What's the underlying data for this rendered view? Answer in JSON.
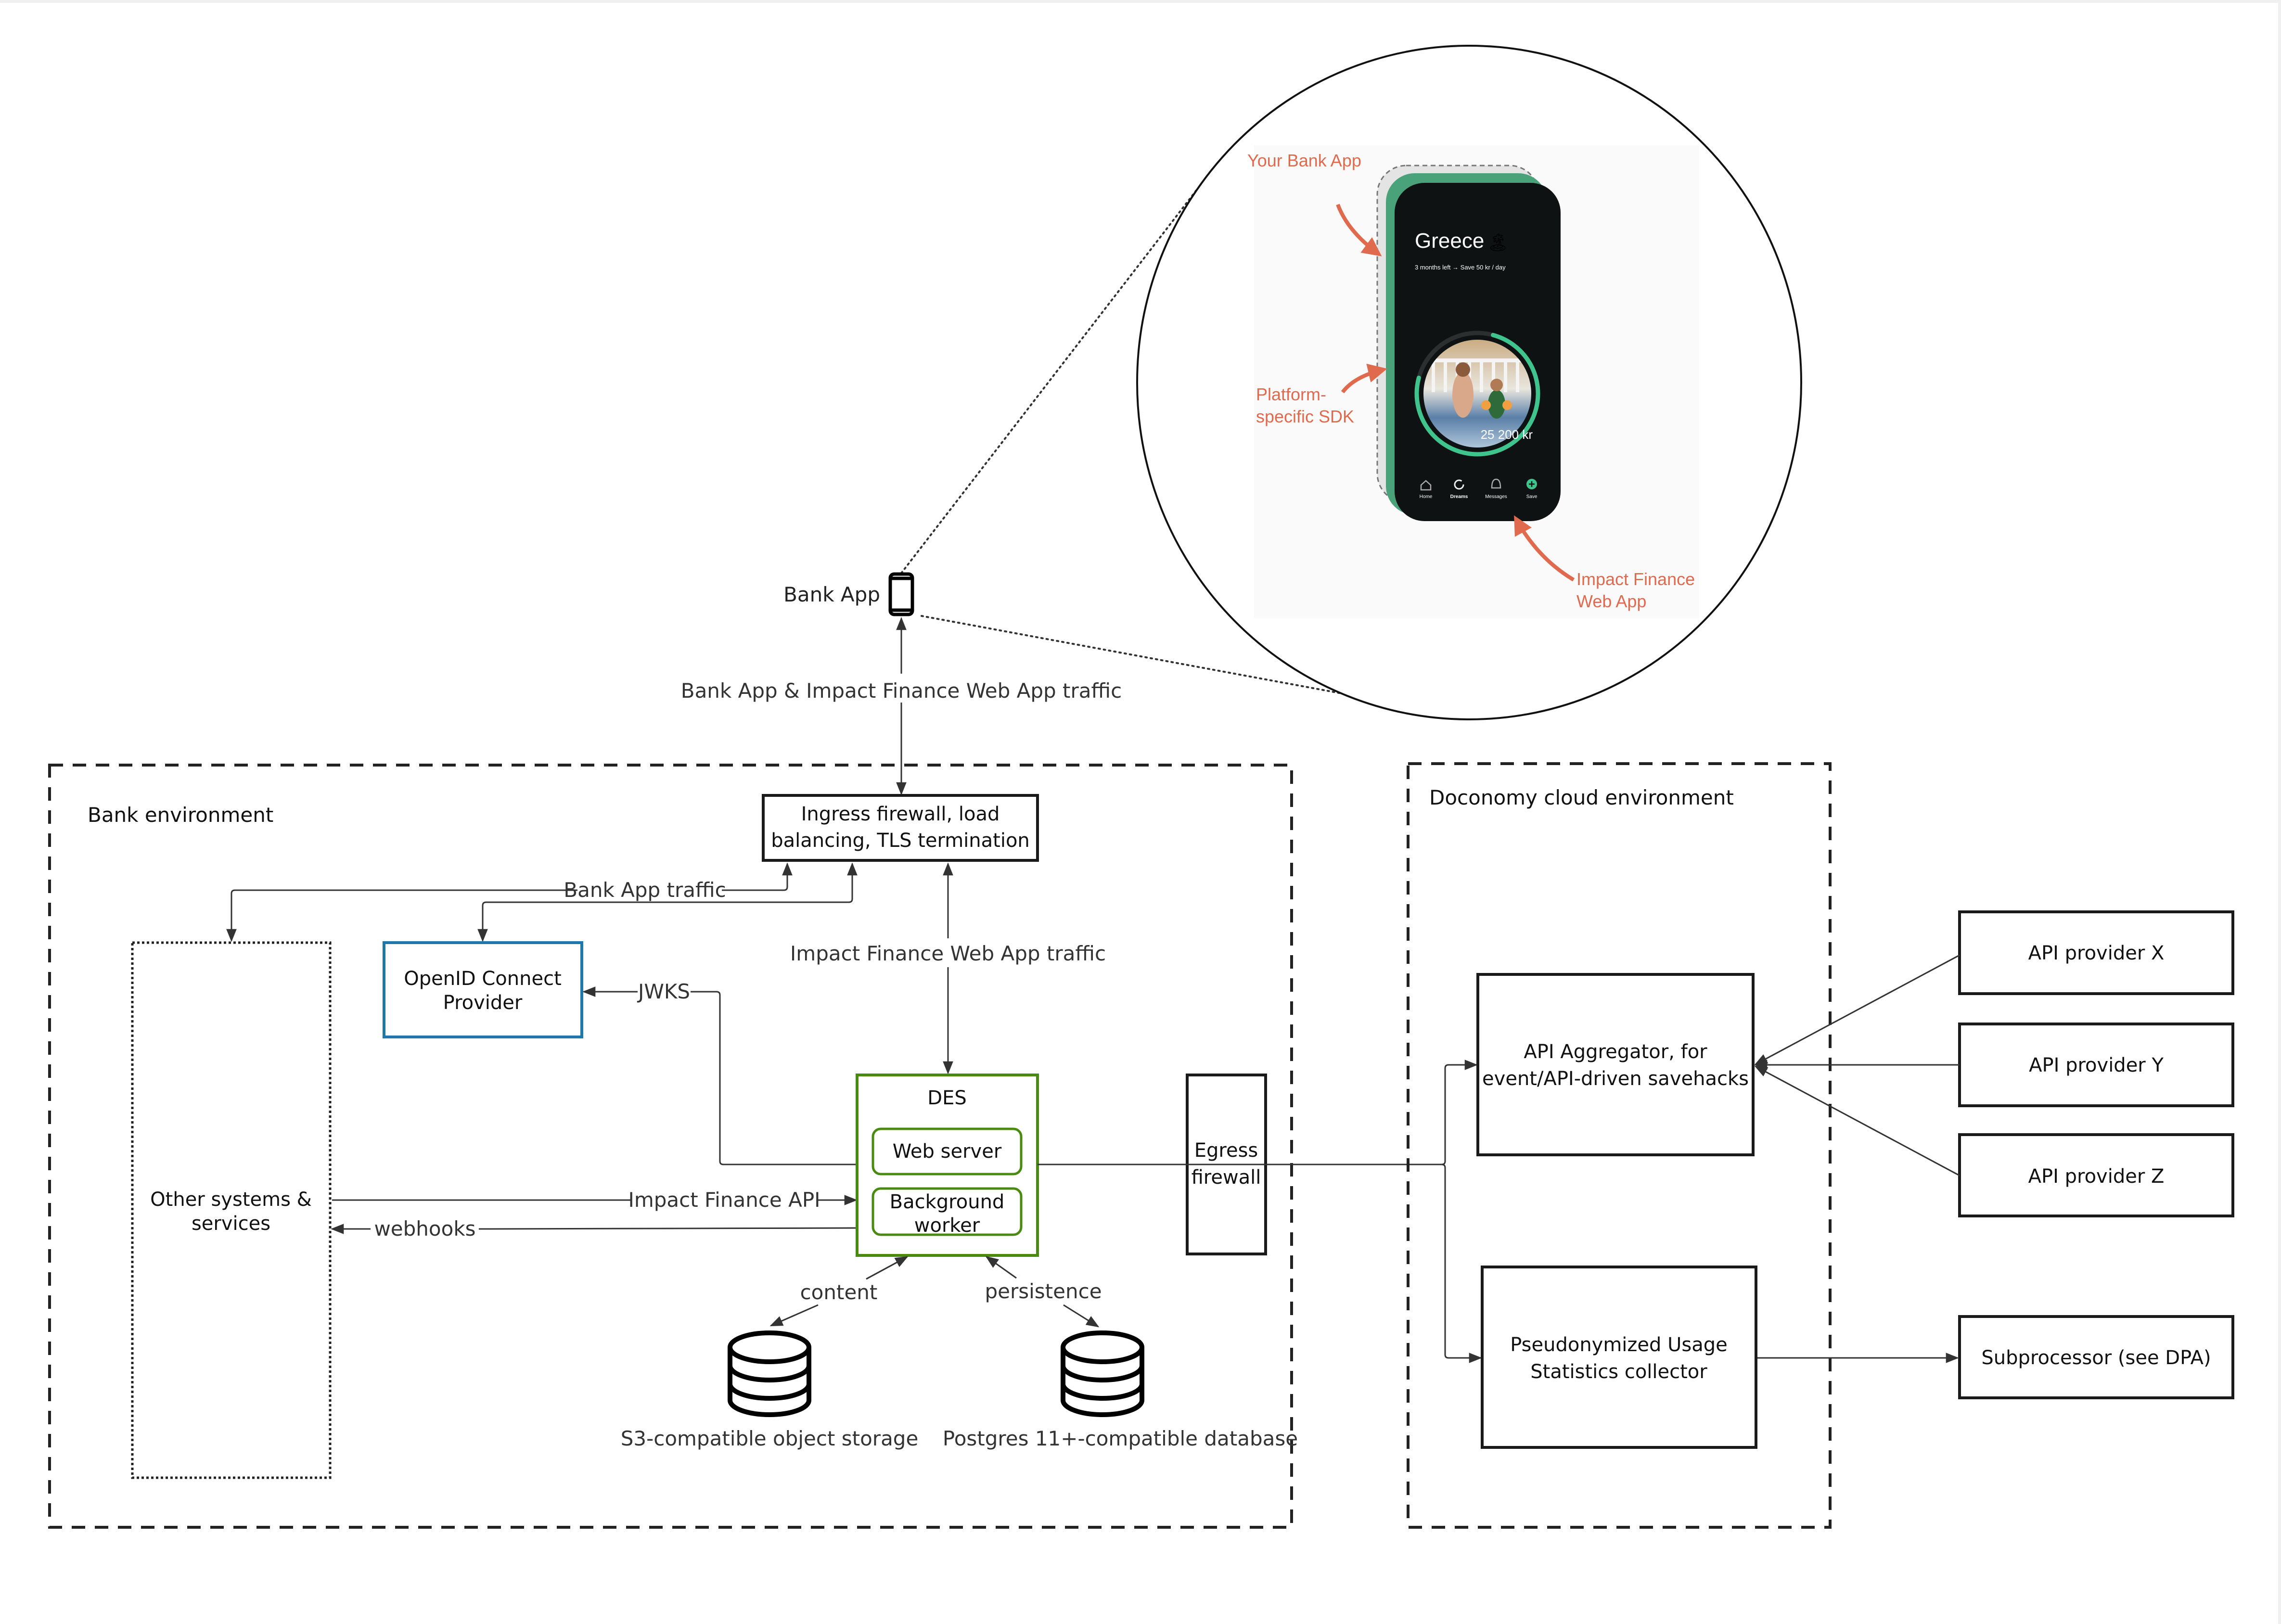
{
  "colors": {
    "line": "#333333",
    "box_border": "#1a1a1a",
    "des_green": "#4a8a10",
    "oidc_blue": "#1f78a8",
    "annotation_orange": "#e06a4e",
    "phone_bg": "#0f1212",
    "phone_green": "#4aa27a",
    "progress_green": "#3ec48c"
  },
  "top": {
    "bank_app_label": "Bank App",
    "bank_app_icon": "smartphone-icon",
    "edge_bank_ingress": "Bank App & Impact Finance Web App traffic"
  },
  "callout": {
    "annotations": {
      "your_bank_app": "Your Bank App",
      "sdk_line1": "Platform-",
      "sdk_line2": "specific SDK",
      "web_app_line1": "Impact Finance",
      "web_app_line2": "Web App"
    },
    "phone": {
      "title": "Greece",
      "title_emoji": "🏝",
      "subtitle": "3 months left → Save 50 kr / day",
      "amount": "25 200 kr",
      "progress_fraction": 0.75,
      "nav": [
        {
          "label": "Home",
          "icon": "home-icon"
        },
        {
          "label": "Dreams",
          "icon": "dreams-ring-icon"
        },
        {
          "label": "Messages",
          "icon": "bell-icon"
        },
        {
          "label": "Save",
          "icon": "plus-circle-icon"
        }
      ]
    }
  },
  "bank_env": {
    "label": "Bank environment",
    "ingress": {
      "line1": "Ingress firewall, load",
      "line2": "balancing, TLS termination"
    },
    "edge_bank_app_traffic": "Bank App traffic",
    "edge_web_app_traffic": "Impact Finance Web App traffic",
    "oidc": {
      "line1": "OpenID Connect",
      "line2": "Provider"
    },
    "edge_jwks": "JWKS",
    "other_systems": {
      "line1": "Other systems &",
      "line2": "services"
    },
    "edge_api": "Impact Finance API",
    "edge_webhooks": "webhooks",
    "des": {
      "title": "DES",
      "web_server": "Web server",
      "worker_line1": "Background",
      "worker_line2": "worker"
    },
    "egress": {
      "line1": "Egress",
      "line2": "firewall"
    },
    "edge_content": "content",
    "edge_persistence": "persistence",
    "s3_label": "S3-compatible object storage",
    "postgres_label": "Postgres 11+-compatible database"
  },
  "doconomy_env": {
    "label": "Doconomy cloud environment",
    "aggregator": {
      "line1": "API Aggregator, for",
      "line2": "event/API-driven savehacks"
    },
    "stats": {
      "line1": "Pseudonymized Usage",
      "line2": "Statistics collector"
    }
  },
  "external": {
    "api_x": "API provider X",
    "api_y": "API provider Y",
    "api_z": "API provider Z",
    "subprocessor": "Subprocessor (see DPA)"
  }
}
